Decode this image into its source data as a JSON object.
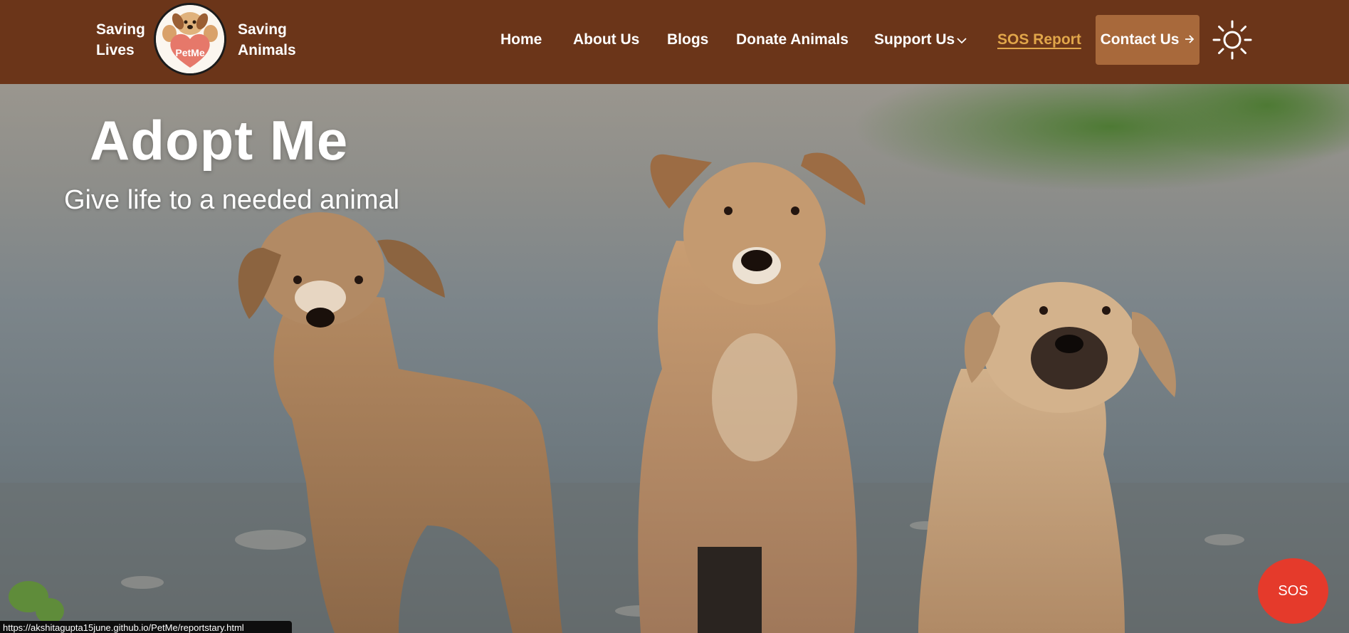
{
  "brand": {
    "tagline_left": [
      "Saving",
      "Lives"
    ],
    "tagline_right": [
      "Saving",
      "Animals"
    ],
    "logo_text": "PetMe",
    "logo_icon": "dog-heart-logo"
  },
  "nav": {
    "home": "Home",
    "about": "About Us",
    "blogs": "Blogs",
    "donate": "Donate Animals",
    "support": "Support Us",
    "support_icon": "chevron-down-icon",
    "sos_report": "SOS Report",
    "contact": "Contact Us",
    "contact_icon": "arrow-right-icon",
    "theme_icon": "sun-icon"
  },
  "hero": {
    "title": "Adopt Me",
    "subtitle": "Give life to a needed animal",
    "image": "three-puppies-photo"
  },
  "sos_button": "SOS",
  "status_url": "https://akshitagupta15june.github.io/PetMe/reportstary.html",
  "colors": {
    "navbar_bg": "#6b3519",
    "contact_bg": "#a8693b",
    "sos_link": "#e1a64a",
    "sos_button_bg": "#e53a2b"
  }
}
